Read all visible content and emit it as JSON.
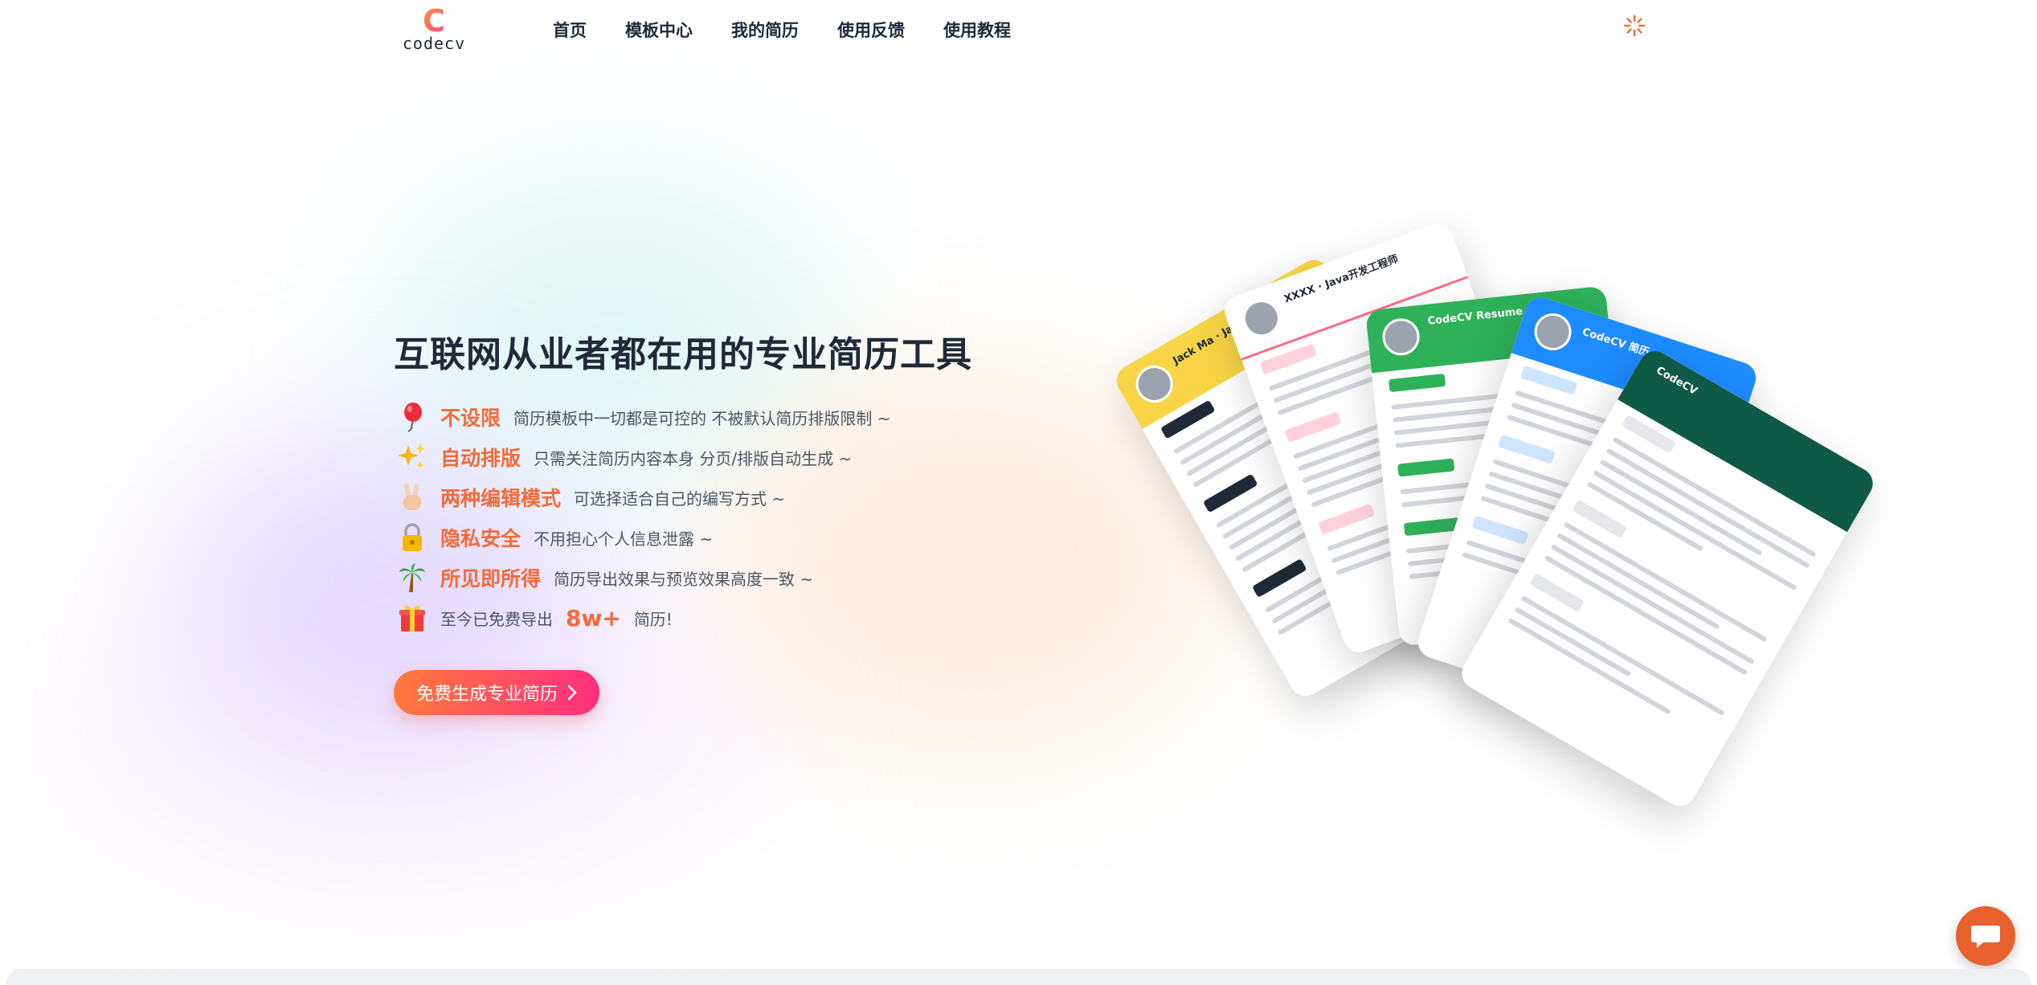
{
  "brand": {
    "logo_text": "codecv",
    "logo_letter": "C"
  },
  "nav": {
    "items": [
      {
        "label": "首页"
      },
      {
        "label": "模板中心"
      },
      {
        "label": "我的简历"
      },
      {
        "label": "使用反馈"
      },
      {
        "label": "使用教程"
      }
    ]
  },
  "hero": {
    "title": "互联网从业者都在用的专业简历工具",
    "features": [
      {
        "icon": "balloon-icon",
        "title": "不设限",
        "desc": "简历模板中一切都是可控的 不被默认简历排版限制 ~"
      },
      {
        "icon": "sparkles-icon",
        "title": "自动排版",
        "desc": "只需关注简历内容本身 分页/排版自动生成 ~"
      },
      {
        "icon": "victory-hand-icon",
        "title": "两种编辑模式",
        "desc": "可选择适合自己的编写方式 ~"
      },
      {
        "icon": "lock-icon",
        "title": "隐私安全",
        "desc": "不用担心个人信息泄露 ~"
      },
      {
        "icon": "palm-tree-icon",
        "title": "所见即所得",
        "desc": "简历导出效果与预览效果高度一致 ~"
      }
    ],
    "stat": {
      "icon": "gift-icon",
      "prefix": "至今已免费导出",
      "count": "8w+",
      "suffix": "简历!"
    },
    "cta_label": "免费生成专业简历"
  },
  "resume_cards": [
    {
      "name": "Jack Ma · Java高级开发工程师",
      "accent": "#f7d547"
    },
    {
      "name": "XXXX · Java开发工程师",
      "accent": "#ff6b8a"
    },
    {
      "name": "CodeCV Resume",
      "accent": "#2fb15a"
    },
    {
      "name": "CodeCV 简历",
      "accent": "#1e8bff"
    },
    {
      "name": "CodeCV",
      "accent": "#0f5a46"
    }
  ],
  "colors": {
    "accent": "#f26b3a",
    "cta_from": "#ff7a3c",
    "cta_to": "#ff2e7e",
    "chat": "#e8602c"
  }
}
